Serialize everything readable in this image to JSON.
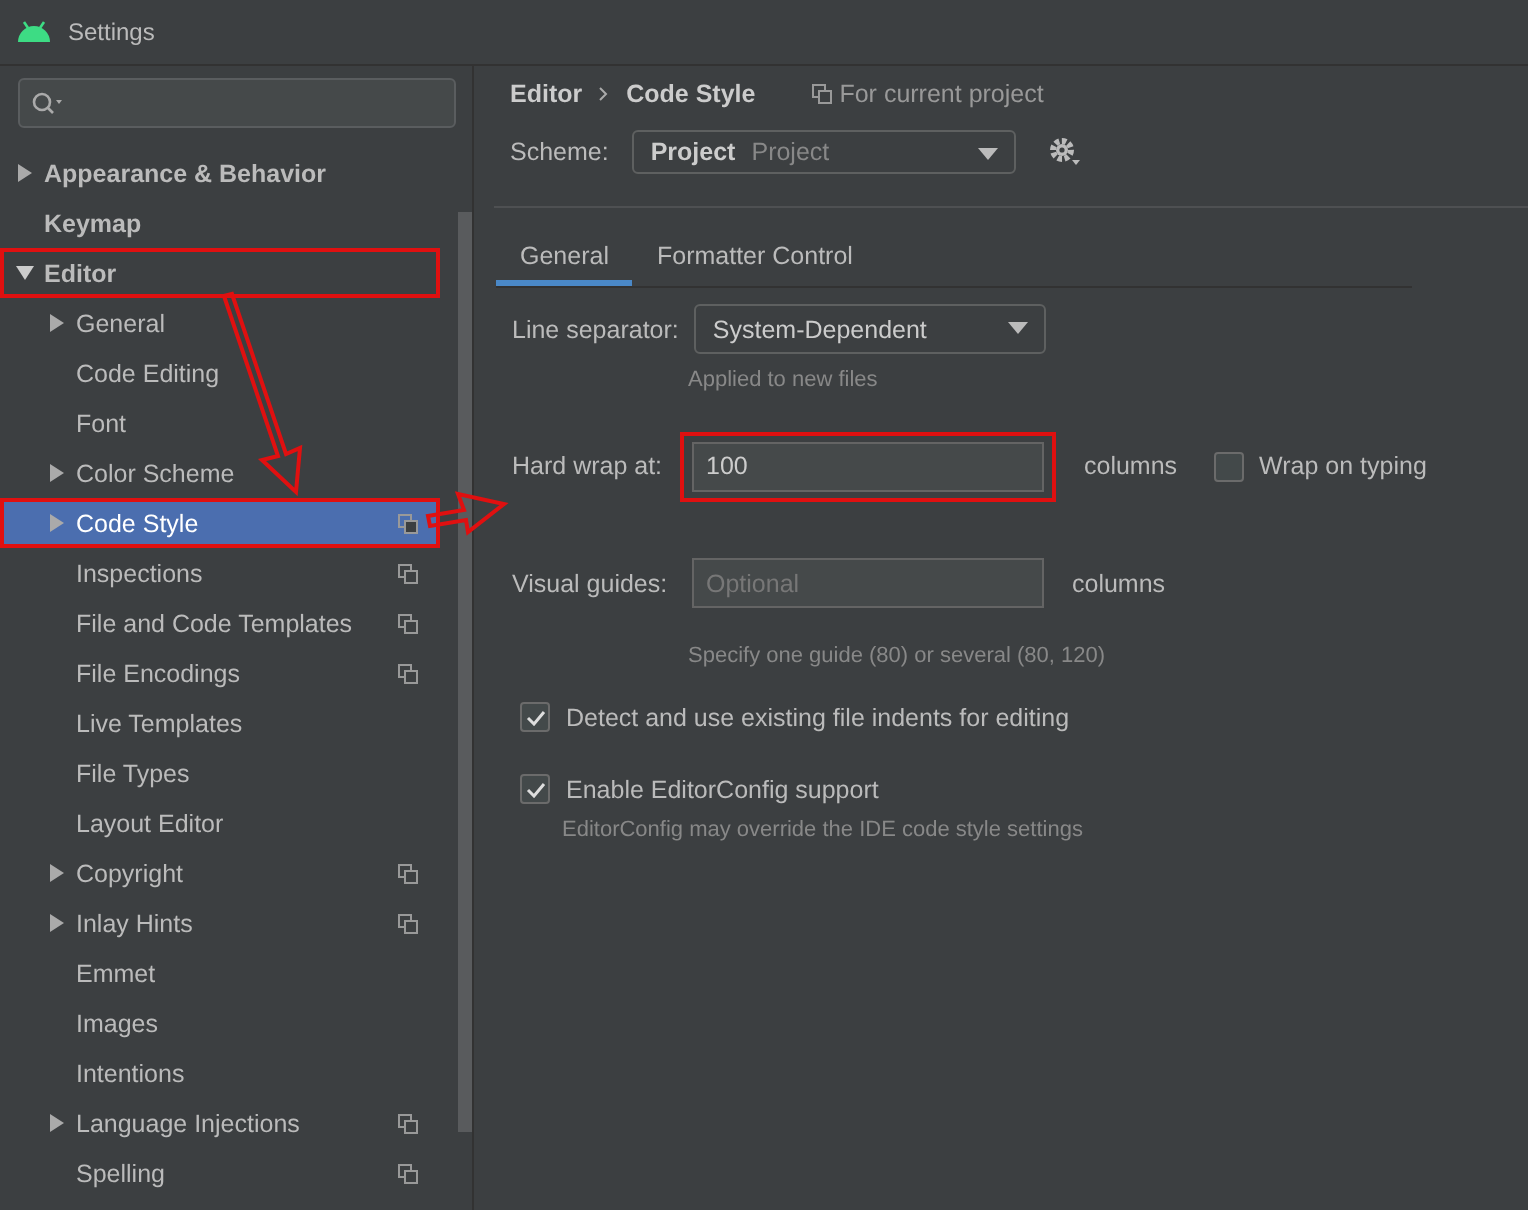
{
  "window": {
    "title": "Settings"
  },
  "tree": [
    {
      "label": "Appearance & Behavior",
      "expanded": false,
      "selected": false,
      "highlighted": false,
      "project_scope": false
    },
    {
      "label": "Keymap",
      "selected": false,
      "highlighted": false,
      "project_scope": false
    },
    {
      "label": "Editor",
      "expanded": true,
      "selected": false,
      "highlighted": true,
      "project_scope": false,
      "children": [
        {
          "label": "General",
          "expanded": false,
          "selected": false,
          "highlighted": false,
          "project_scope": false
        },
        {
          "label": "Code Editing",
          "selected": false,
          "highlighted": false,
          "project_scope": false
        },
        {
          "label": "Font",
          "selected": false,
          "highlighted": false,
          "project_scope": false
        },
        {
          "label": "Color Scheme",
          "expanded": false,
          "selected": false,
          "highlighted": false,
          "project_scope": false
        },
        {
          "label": "Code Style",
          "expanded": false,
          "selected": true,
          "highlighted": true,
          "project_scope": true
        },
        {
          "label": "Inspections",
          "selected": false,
          "highlighted": false,
          "project_scope": true
        },
        {
          "label": "File and Code Templates",
          "selected": false,
          "highlighted": false,
          "project_scope": true
        },
        {
          "label": "File Encodings",
          "selected": false,
          "highlighted": false,
          "project_scope": true
        },
        {
          "label": "Live Templates",
          "selected": false,
          "highlighted": false,
          "project_scope": false
        },
        {
          "label": "File Types",
          "selected": false,
          "highlighted": false,
          "project_scope": false
        },
        {
          "label": "Layout Editor",
          "selected": false,
          "highlighted": false,
          "project_scope": false
        },
        {
          "label": "Copyright",
          "expanded": false,
          "selected": false,
          "highlighted": false,
          "project_scope": true
        },
        {
          "label": "Inlay Hints",
          "expanded": false,
          "selected": false,
          "highlighted": false,
          "project_scope": true
        },
        {
          "label": "Emmet",
          "selected": false,
          "highlighted": false,
          "project_scope": false
        },
        {
          "label": "Images",
          "selected": false,
          "highlighted": false,
          "project_scope": false
        },
        {
          "label": "Intentions",
          "selected": false,
          "highlighted": false,
          "project_scope": false
        },
        {
          "label": "Language Injections",
          "expanded": false,
          "selected": false,
          "highlighted": false,
          "project_scope": true
        },
        {
          "label": "Spelling",
          "selected": false,
          "highlighted": false,
          "project_scope": true
        }
      ]
    }
  ],
  "breadcrumb": [
    "Editor",
    "Code Style"
  ],
  "scope_note": "For current project",
  "scheme": {
    "label": "Scheme:",
    "name": "Project",
    "type": "Project"
  },
  "tabs": [
    {
      "label": "General",
      "selected": true
    },
    {
      "label": "Formatter Control",
      "selected": false
    }
  ],
  "line_separator": {
    "label": "Line separator:",
    "value": "System-Dependent",
    "hint": "Applied to new files"
  },
  "hard_wrap": {
    "label": "Hard wrap at:",
    "value": "100",
    "unit": "columns",
    "highlighted": true,
    "wrap_on_typing": {
      "label": "Wrap on typing",
      "checked": false
    }
  },
  "visual_guides": {
    "label": "Visual guides:",
    "placeholder": "Optional",
    "unit": "columns",
    "hint": "Specify one guide (80) or several (80, 120)"
  },
  "options": [
    {
      "label": "Detect and use existing file indents for editing",
      "checked": true
    },
    {
      "label": "Enable EditorConfig support",
      "checked": true,
      "hint": "EditorConfig may override the IDE code style settings"
    }
  ]
}
